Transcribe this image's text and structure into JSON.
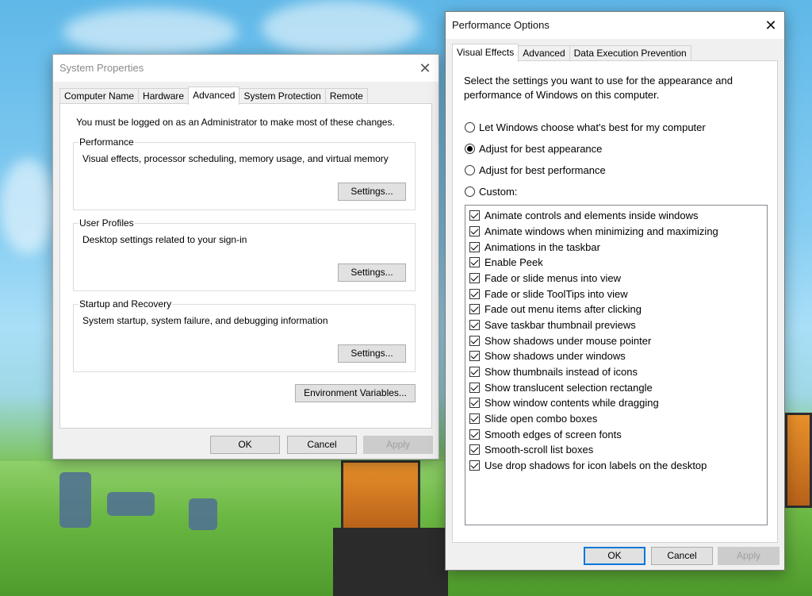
{
  "system_properties": {
    "title": "System Properties",
    "close_glyph": "✕",
    "tabs": [
      "Computer Name",
      "Hardware",
      "Advanced",
      "System Protection",
      "Remote"
    ],
    "active_tab": "Advanced",
    "admin_note": "You must be logged on as an Administrator to make most of these changes.",
    "groups": [
      {
        "title": "Performance",
        "description": "Visual effects, processor scheduling, memory usage, and virtual memory",
        "button": "Settings..."
      },
      {
        "title": "User Profiles",
        "description": "Desktop settings related to your sign-in",
        "button": "Settings..."
      },
      {
        "title": "Startup and Recovery",
        "description": "System startup, system failure, and debugging information",
        "button": "Settings..."
      }
    ],
    "env_button": "Environment Variables...",
    "ok": "OK",
    "cancel": "Cancel",
    "apply": "Apply"
  },
  "performance_options": {
    "title": "Performance Options",
    "close_glyph": "✕",
    "tabs": [
      "Visual Effects",
      "Advanced",
      "Data Execution Prevention"
    ],
    "active_tab": "Visual Effects",
    "intro": "Select the settings you want to use for the appearance and performance of Windows on this computer.",
    "radio_options": [
      {
        "label": "Let Windows choose what's best for my computer",
        "checked": false
      },
      {
        "label": "Adjust for best appearance",
        "checked": true
      },
      {
        "label": "Adjust for best performance",
        "checked": false
      },
      {
        "label": "Custom:",
        "checked": false
      }
    ],
    "effects": [
      {
        "label": "Animate controls and elements inside windows",
        "checked": true
      },
      {
        "label": "Animate windows when minimizing and maximizing",
        "checked": true
      },
      {
        "label": "Animations in the taskbar",
        "checked": true
      },
      {
        "label": "Enable Peek",
        "checked": true
      },
      {
        "label": "Fade or slide menus into view",
        "checked": true
      },
      {
        "label": "Fade or slide ToolTips into view",
        "checked": true
      },
      {
        "label": "Fade out menu items after clicking",
        "checked": true
      },
      {
        "label": "Save taskbar thumbnail previews",
        "checked": true
      },
      {
        "label": "Show shadows under mouse pointer",
        "checked": true
      },
      {
        "label": "Show shadows under windows",
        "checked": true
      },
      {
        "label": "Show thumbnails instead of icons",
        "checked": true
      },
      {
        "label": "Show translucent selection rectangle",
        "checked": true
      },
      {
        "label": "Show window contents while dragging",
        "checked": true
      },
      {
        "label": "Slide open combo boxes",
        "checked": true
      },
      {
        "label": "Smooth edges of screen fonts",
        "checked": true
      },
      {
        "label": "Smooth-scroll list boxes",
        "checked": true
      },
      {
        "label": "Use drop shadows for icon labels on the desktop",
        "checked": true
      }
    ],
    "ok": "OK",
    "cancel": "Cancel",
    "apply": "Apply"
  }
}
